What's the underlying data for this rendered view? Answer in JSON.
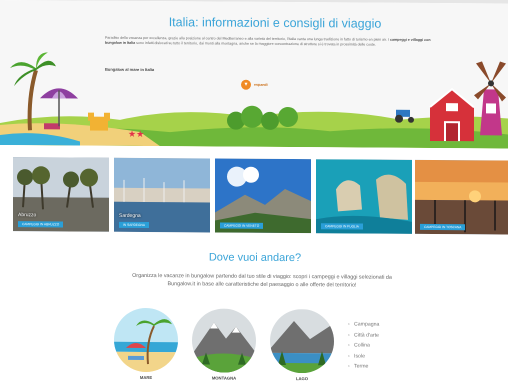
{
  "header": {
    "title": "Italia: informazioni e consigli di viaggio",
    "intro_plain": "Paradiso della vacanza per eccellenza, grazie alla posizione al centro del Mediterraneo e alla varietà del territorio, l'Italia vanta una lunga tradizione in fatto di turismo en plein air. I ",
    "intro_bold": "campeggi e villaggi con bungalow in Italia",
    "intro_rest": " sono infatti dislocati su tutto il territorio, dai monti alla montagna, anche se la maggiore concentrazione di strutture si è trovata in prossimità delle coste.",
    "more_link": "Bungalow al mare in Italia",
    "expand_label": "espandi"
  },
  "cards": [
    {
      "name": "Abruzzo",
      "button": "CAMPEGGI IN ABRUZZO"
    },
    {
      "name": "Sardegna",
      "button": "IN SARDEGNA"
    },
    {
      "name": "",
      "button": "CAMPEGGI IN VENETO"
    },
    {
      "name": "",
      "button": "CAMPEGGI IN PUGLIA"
    },
    {
      "name": "",
      "button": "CAMPEGGI IN TOSCANA"
    }
  ],
  "section": {
    "title": "Dove vuoi andare?",
    "text": "Organizza le vacanze in bungalow partendo dal tuo stile di viaggio: scopri i campeggi e villaggi selezionati da Bungalow.it in base alle caratteristiche del paesaggio o alle offerte del territorio!",
    "categories": [
      "MARE",
      "MONTAGNA",
      "LAGO"
    ],
    "list": [
      "Campagna",
      "Città d'arte",
      "Collina",
      "Isole",
      "Terme"
    ]
  },
  "colors": {
    "accent": "#3aa4d8",
    "orange": "#f08a24",
    "button": "#2a9fd8"
  }
}
